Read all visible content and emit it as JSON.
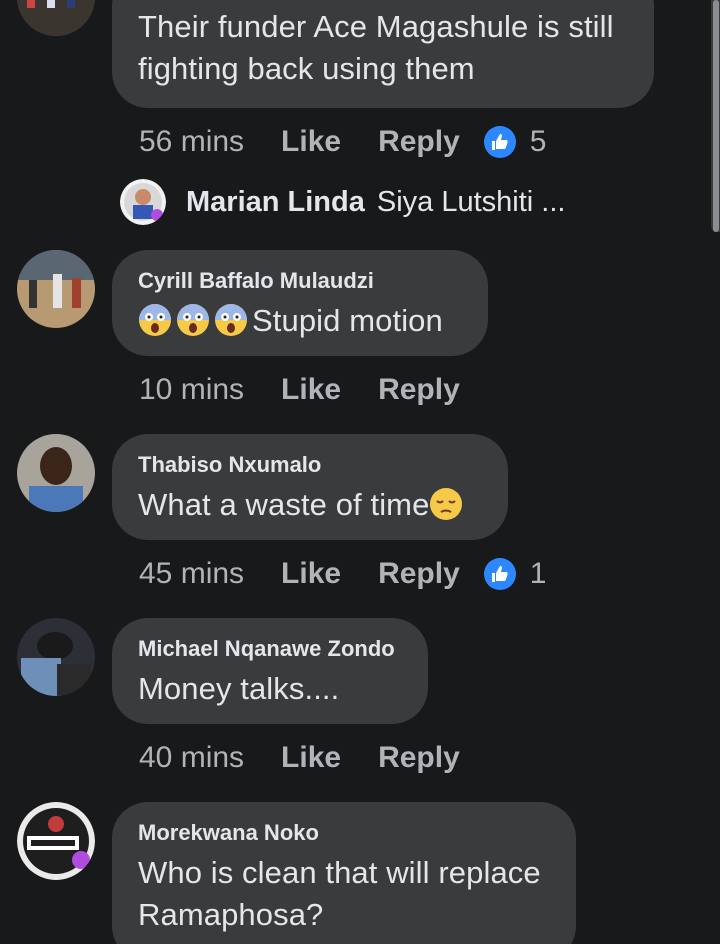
{
  "comments": [
    {
      "author": "",
      "text_lines": [
        "Their funder Ace Magashule is still",
        "fighting back using them"
      ],
      "time": "56 mins",
      "like_label": "Like",
      "reply_label": "Reply",
      "reaction_count": "5",
      "reaction_icon": "like-icon"
    },
    {
      "author": "Cyrill Baffalo Mulaudzi",
      "text": "Stupid motion",
      "emoji": "face-screaming-in-fear",
      "time": "10 mins",
      "like_label": "Like",
      "reply_label": "Reply"
    },
    {
      "author": "Thabiso Nxumalo",
      "text": "What a waste of time",
      "emoji": "pensive-face",
      "time": "45 mins",
      "like_label": "Like",
      "reply_label": "Reply",
      "reaction_count": "1",
      "reaction_icon": "like-icon"
    },
    {
      "author": "Michael Nqanawe Zondo",
      "text": "Money talks....",
      "time": "40 mins",
      "like_label": "Like",
      "reply_label": "Reply"
    },
    {
      "author": "Morekwana Noko",
      "text_lines": [
        "Who is clean that will replace",
        "Ramaphosa?"
      ]
    }
  ],
  "reply_preview": {
    "name": "Marian Linda",
    "snippet": "Siya Lutshiti ..."
  },
  "colors": {
    "background": "#18191a",
    "bubble": "#3a3b3c",
    "accent": "#2d88ff",
    "meta_text": "#b0b3b8"
  }
}
